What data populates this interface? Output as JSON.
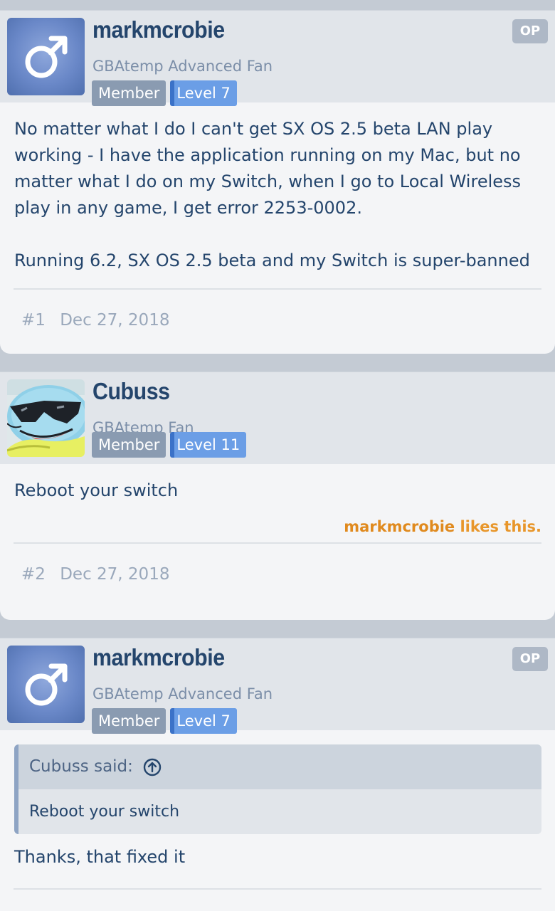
{
  "posts": [
    {
      "author": "markmcrobie",
      "user_title": "GBAtemp Advanced Fan",
      "badges": {
        "member": "Member",
        "level": "Level 7"
      },
      "op_label": "OP",
      "avatar_icon": "male-symbol-icon",
      "message": [
        "No matter what I do I can't get SX OS 2.5 beta LAN play working - I have the application running on my Mac, but no matter what I do on my Switch, when I go to Local Wireless play in any game, I get error 2253-0002.",
        "Running 6.2, SX OS 2.5 beta and my Switch is super-banned"
      ],
      "post_number": "#1",
      "date": "Dec 27, 2018"
    },
    {
      "author": "Cubuss",
      "user_title": "GBAtemp Fan",
      "badges": {
        "member": "Member",
        "level": "Level 11"
      },
      "avatar_icon": "squirtle-sunglasses-avatar",
      "message": [
        "Reboot your switch"
      ],
      "likes": {
        "who": "markmcrobie",
        "suffix": " likes this."
      },
      "post_number": "#2",
      "date": "Dec 27, 2018"
    },
    {
      "author": "markmcrobie",
      "user_title": "GBAtemp Advanced Fan",
      "badges": {
        "member": "Member",
        "level": "Level 7"
      },
      "op_label": "OP",
      "avatar_icon": "male-symbol-icon",
      "quote": {
        "header": "Cubuss said:",
        "icon": "arrow-up-circle-icon",
        "text": "Reboot your switch"
      },
      "message": [
        "Thanks, that fixed it"
      ]
    }
  ],
  "colors": {
    "page_bg": "#c4cbd4",
    "header_bg": "#e1e5ea",
    "text": "#24456c",
    "member_badge": "#8a9bb1",
    "level_badge": "#6b9ee6",
    "likes": "#e8962a"
  }
}
